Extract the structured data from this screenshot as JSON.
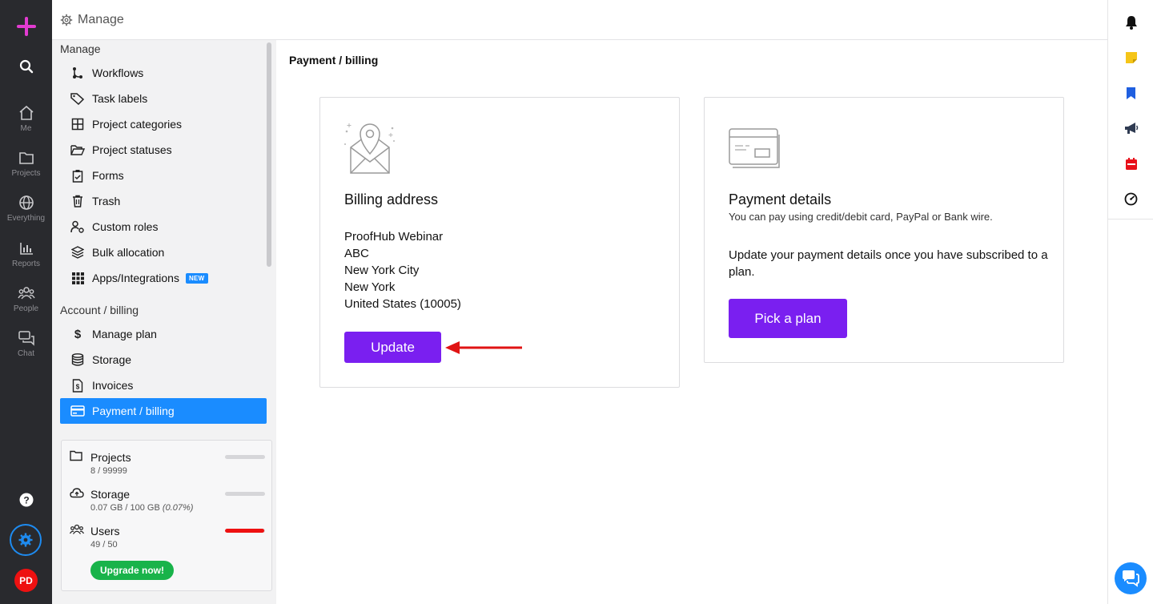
{
  "topbar": {
    "title": "Manage"
  },
  "rail": {
    "items": [
      {
        "label": "Me",
        "icon": "home-icon"
      },
      {
        "label": "Projects",
        "icon": "folder-icon"
      },
      {
        "label": "Everything",
        "icon": "globe-icon"
      },
      {
        "label": "Reports",
        "icon": "bar-chart-icon"
      },
      {
        "label": "People",
        "icon": "people-icon"
      },
      {
        "label": "Chat",
        "icon": "chat-icon"
      }
    ],
    "avatar_initials": "PD",
    "accent": "#e23bd1",
    "background": "#292a2e"
  },
  "sidebar": {
    "manage_title": "Manage",
    "manage_items": [
      {
        "label": "Workflows",
        "icon": "workflow-icon"
      },
      {
        "label": "Task labels",
        "icon": "tag-icon"
      },
      {
        "label": "Project categories",
        "icon": "grid-icon"
      },
      {
        "label": "Project statuses",
        "icon": "folder-open-icon"
      },
      {
        "label": "Forms",
        "icon": "clipboard-icon"
      },
      {
        "label": "Trash",
        "icon": "trash-icon"
      },
      {
        "label": "Custom roles",
        "icon": "user-role-icon"
      },
      {
        "label": "Bulk allocation",
        "icon": "layers-icon"
      },
      {
        "label": "Apps/Integrations",
        "icon": "apps-icon",
        "badge": "NEW"
      }
    ],
    "billing_title": "Account / billing",
    "billing_items": [
      {
        "label": "Manage plan",
        "icon": "dollar-icon"
      },
      {
        "label": "Storage",
        "icon": "database-icon"
      },
      {
        "label": "Invoices",
        "icon": "invoice-icon"
      },
      {
        "label": "Payment / billing",
        "icon": "card-icon",
        "active": true
      }
    ]
  },
  "usage": {
    "projects": {
      "label": "Projects",
      "value": "8 / 99999",
      "fraction": 0.0001,
      "color": "#d6d6d9"
    },
    "storage": {
      "label": "Storage",
      "value": "0.07 GB / 100 GB",
      "percent": "(0.07%)",
      "fraction": 0.0007,
      "color": "#d6d6d9"
    },
    "users": {
      "label": "Users",
      "value": "49 / 50",
      "fraction": 0.98,
      "color": "#ee1111"
    },
    "upgrade_label": "Upgrade now!"
  },
  "main": {
    "breadcrumb": "Payment / billing",
    "billing": {
      "title": "Billing address",
      "lines": [
        "ProofHub Webinar",
        "ABC",
        "New York City",
        "New York",
        "United States (10005)"
      ],
      "button": "Update"
    },
    "payment": {
      "title": "Payment details",
      "subtitle": "You can pay using credit/debit card, PayPal or Bank wire.",
      "text": "Update your payment details once you have subscribed to a plan.",
      "button": "Pick a plan"
    },
    "primary_color": "#7a1ff0",
    "annotation_arrow_color": "#e01414"
  },
  "right_rail": [
    "bell-icon",
    "sticky-note-icon",
    "bookmark-icon",
    "megaphone-icon",
    "calendar-icon",
    "timer-icon"
  ]
}
